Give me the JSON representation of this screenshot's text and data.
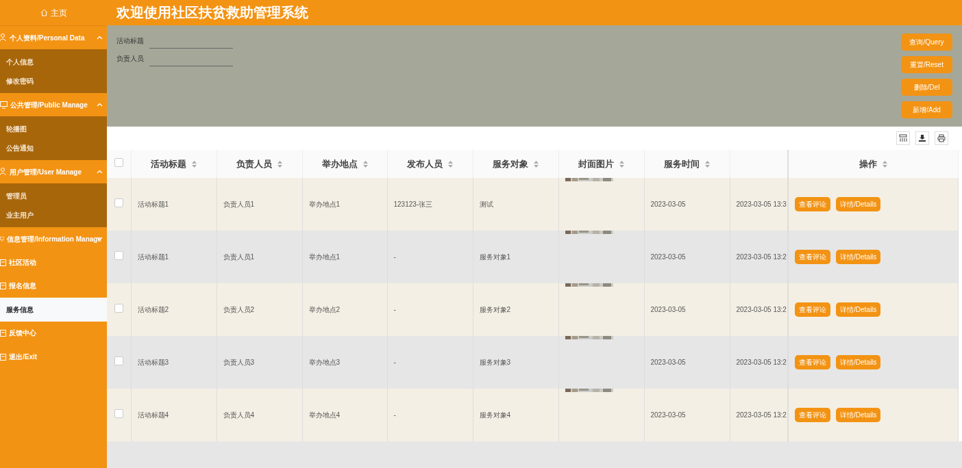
{
  "sidebar": {
    "home": {
      "label": "主页"
    },
    "items": [
      {
        "kind": "group",
        "label": "个人资料/Personal Data",
        "expanded": true,
        "children": [
          {
            "label": "个人信息",
            "selected": false
          },
          {
            "label": "修改密码",
            "selected": false
          }
        ]
      },
      {
        "kind": "group",
        "label": "公共管理/Public Manage",
        "expanded": true,
        "children": [
          {
            "label": "轮播图",
            "selected": false
          },
          {
            "label": "公告通知",
            "selected": false
          }
        ]
      },
      {
        "kind": "group",
        "label": "用户管理/User Manage",
        "expanded": true,
        "children": [
          {
            "label": "管理员",
            "selected": false
          },
          {
            "label": "业主用户",
            "selected": false
          }
        ]
      },
      {
        "kind": "group",
        "label": "信息管理/Information Manage",
        "expanded": false
      },
      {
        "kind": "item",
        "label": "社区活动",
        "selected": false
      },
      {
        "kind": "item",
        "label": "报名信息",
        "selected": false
      },
      {
        "kind": "item",
        "label": "服务信息",
        "selected": true
      },
      {
        "kind": "item",
        "label": "反馈中心",
        "selected": false
      },
      {
        "kind": "item",
        "label": "退出/Exit",
        "selected": false
      }
    ]
  },
  "header": {
    "title": "欢迎使用社区扶贫救助管理系统"
  },
  "search": {
    "fields": [
      {
        "label": "活动标题"
      },
      {
        "label": "负责人员"
      }
    ],
    "buttons": [
      "查询/Query",
      "重置/Reset",
      "删除/Del",
      "新增/Add"
    ]
  },
  "table": {
    "all_checked": false,
    "columns": [
      "活动标题",
      "负责人员",
      "举办地点",
      "发布人员",
      "服务对象",
      "封面图片",
      "服务时间",
      "",
      "操作"
    ],
    "rows": [
      {
        "cells": [
          "活动标题1",
          "负责人员1",
          "举办地点1",
          "123123-张三",
          "测试",
          "",
          "2023-03-05",
          "2023-03-05 13:3"
        ],
        "checked": false,
        "actions": [
          "查看评论",
          "详情/Details"
        ]
      },
      {
        "cells": [
          "活动标题1",
          "负责人员1",
          "举办地点1",
          "-",
          "服务对象1",
          "",
          "2023-03-05",
          "2023-03-05 13:2"
        ],
        "checked": false,
        "actions": [
          "查看评论",
          "详情/Details"
        ]
      },
      {
        "cells": [
          "活动标题2",
          "负责人员2",
          "举办地点2",
          "-",
          "服务对象2",
          "",
          "2023-03-05",
          "2023-03-05 13:2"
        ],
        "checked": false,
        "actions": [
          "查看评论",
          "详情/Details"
        ]
      },
      {
        "cells": [
          "活动标题3",
          "负责人员3",
          "举办地点3",
          "-",
          "服务对象3",
          "",
          "2023-03-05",
          "2023-03-05 13:2"
        ],
        "checked": false,
        "actions": [
          "查看评论",
          "详情/Details"
        ]
      },
      {
        "cells": [
          "活动标题4",
          "负责人员4",
          "举办地点4",
          "-",
          "服务对象4",
          "",
          "2023-03-05",
          "2023-03-05 13:2"
        ],
        "checked": false,
        "actions": [
          "查看评论",
          "详情/Details"
        ]
      }
    ]
  }
}
